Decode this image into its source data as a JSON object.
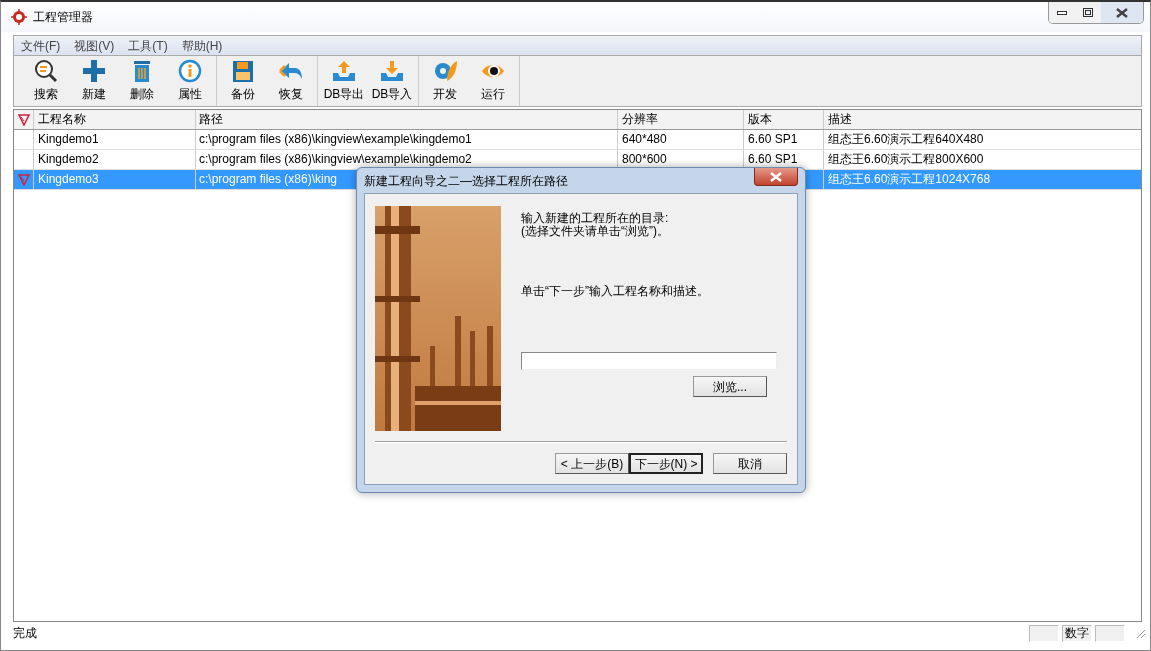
{
  "window": {
    "title": "工程管理器"
  },
  "menu": [
    {
      "label": "文件(F)"
    },
    {
      "label": "视图(V)"
    },
    {
      "label": "工具(T)"
    },
    {
      "label": "帮助(H)"
    }
  ],
  "toolbar_groups": [
    {
      "buttons": [
        {
          "label": "搜索",
          "kind": "search"
        },
        {
          "label": "新建",
          "kind": "new"
        },
        {
          "label": "删除",
          "kind": "delete"
        },
        {
          "label": "属性",
          "kind": "info"
        }
      ]
    },
    {
      "buttons": [
        {
          "label": "备份",
          "kind": "backup"
        },
        {
          "label": "恢复",
          "kind": "restore"
        }
      ]
    },
    {
      "buttons": [
        {
          "label": "DB导出",
          "kind": "export"
        },
        {
          "label": "DB导入",
          "kind": "import"
        }
      ]
    },
    {
      "buttons": [
        {
          "label": "开发",
          "kind": "develop"
        },
        {
          "label": "运行",
          "kind": "run"
        }
      ]
    }
  ],
  "table": {
    "columns": [
      "工程名称",
      "路径",
      "分辨率",
      "版本",
      "描述"
    ],
    "rows": [
      {
        "selected": false,
        "cells": [
          "Kingdemo1",
          "c:\\program files (x86)\\kingview\\example\\kingdemo1",
          "640*480",
          "6.60 SP1",
          "组态王6.60演示工程640X480"
        ]
      },
      {
        "selected": false,
        "cells": [
          "Kingdemo2",
          "c:\\program files (x86)\\kingview\\example\\kingdemo2",
          "800*600",
          "6.60 SP1",
          "组态王6.60演示工程800X600"
        ]
      },
      {
        "selected": true,
        "cells": [
          "Kingdemo3",
          "c:\\program files (x86)\\king",
          null,
          null,
          "组态王6.60演示工程1024X768"
        ]
      }
    ]
  },
  "dialog": {
    "title": "新建工程向导之二—选择工程所在路径",
    "prompt_lines": [
      "输入新建的工程所在的目录:",
      "(选择文件夹请单击“浏览”)。"
    ],
    "hint": "单击“下一步”输入工程名称和描述。",
    "browse_button": "浏览...",
    "buttons": [
      {
        "label": "< 上一步(B)",
        "default": false
      },
      {
        "label": "下一步(N) >",
        "default": true
      },
      {
        "label": "取消",
        "default": false
      }
    ]
  },
  "status_bar": {
    "text": "完成",
    "indicators": [
      {
        "kind": "blank"
      },
      {
        "kind": "text",
        "label": "数字"
      },
      {
        "kind": "blank"
      }
    ]
  }
}
